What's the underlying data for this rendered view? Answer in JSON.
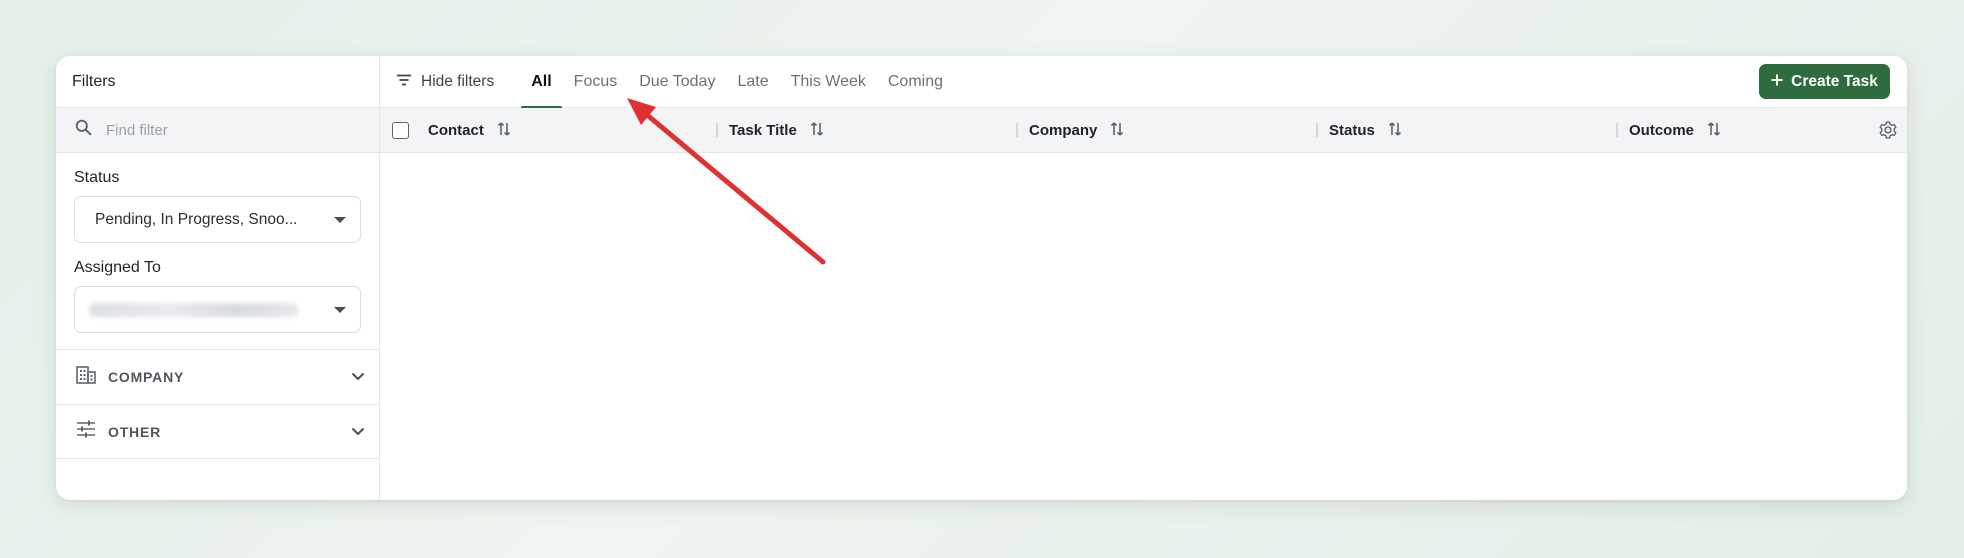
{
  "sidebar": {
    "title": "Filters",
    "search": {
      "placeholder": "Find filter",
      "icon": "search-icon"
    },
    "filters": [
      {
        "label": "Status",
        "value": "Pending, In Progress, Snoo..."
      },
      {
        "label": "Assigned To",
        "value": ""
      }
    ],
    "sections": [
      {
        "title": "COMPANY",
        "icon": "building-icon"
      },
      {
        "title": "OTHER",
        "icon": "sliders-icon"
      }
    ]
  },
  "toolbar": {
    "hide_filters_label": "Hide filters",
    "tabs": [
      "All",
      "Focus",
      "Due Today",
      "Late",
      "This Week",
      "Coming"
    ],
    "active_tab": "All",
    "create_button_label": "Create Task"
  },
  "table": {
    "columns": [
      "Contact",
      "Task Title",
      "Company",
      "Status",
      "Outcome"
    ],
    "rows": []
  },
  "colors": {
    "accent": "#2e6b3e",
    "annotation_arrow": "#e03131"
  }
}
